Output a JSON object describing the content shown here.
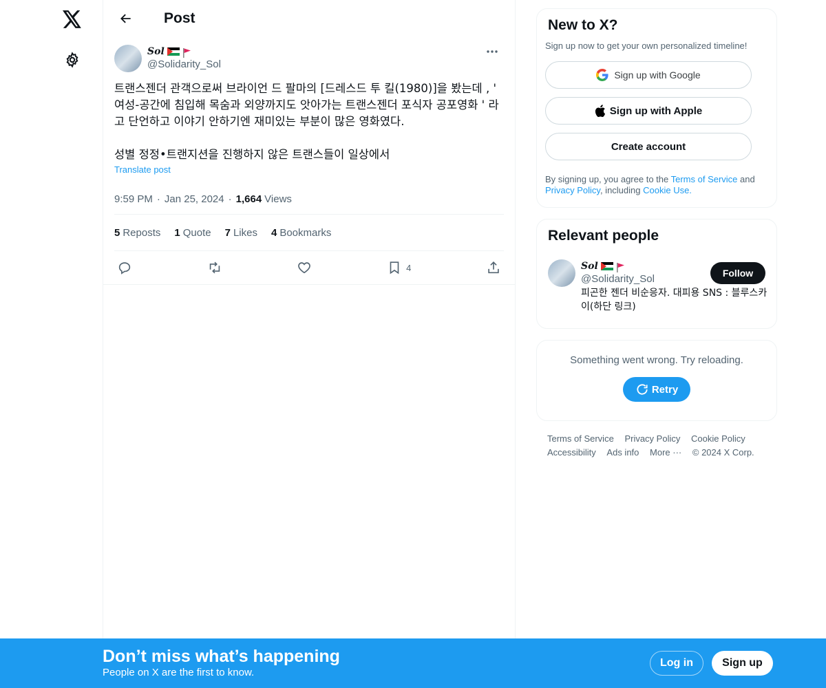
{
  "header": {
    "title": "Post"
  },
  "post": {
    "display_name": "Sol",
    "handle": "@Solidarity_Sol",
    "text_1": "트랜스젠더 관객으로써 브라이언 드 팔마의 [드레스드 투 킬(1980)]을 봤는데 , ' 여성-공간에 침입해 목숨과 외양까지도 앗아가는 트랜스젠더 포식자 공포영화 ' 라고 단언하고 이야기 안하기엔 재미있는 부분이 많은 영화였다.",
    "text_2": "성별 정정•트랜지션을 진행하지 않은 트랜스들이 일상에서",
    "translate": "Translate post",
    "time": "9:59 PM",
    "date": "Jan 25, 2024",
    "views_count": "1,664",
    "views_label": "Views",
    "stats": [
      {
        "count": "5",
        "label": "Reposts"
      },
      {
        "count": "1",
        "label": "Quote"
      },
      {
        "count": "7",
        "label": "Likes"
      },
      {
        "count": "4",
        "label": "Bookmarks"
      }
    ],
    "bookmark_count": "4"
  },
  "signup": {
    "title": "New to X?",
    "subtitle": "Sign up now to get your own personalized timeline!",
    "google": "Sign up with Google",
    "apple": "Sign up with Apple",
    "create": "Create account",
    "terms_1": "By signing up, you agree to the ",
    "terms_tos": "Terms of Service",
    "terms_2": " and ",
    "terms_pp": "Privacy Policy",
    "terms_3": ", including ",
    "terms_cookie": "Cookie Use."
  },
  "people": {
    "title": "Relevant people",
    "display_name": "Sol",
    "handle": "@Solidarity_Sol",
    "follow": "Follow",
    "bio": "피곤한 젠더 비순응자. 대피용 SNS : 블루스카이(하단 링크)"
  },
  "error": {
    "text": "Something went wrong. Try reloading.",
    "retry": "Retry"
  },
  "footer": {
    "links": [
      "Terms of Service",
      "Privacy Policy",
      "Cookie Policy",
      "Accessibility",
      "Ads info",
      "More ···",
      "© 2024 X Corp."
    ]
  },
  "banner": {
    "title": "Don’t miss what’s happening",
    "subtitle": "People on X are the first to know.",
    "login": "Log in",
    "signup": "Sign up"
  },
  "colors": {
    "accent": "#1d9bf0",
    "text": "#0f1419",
    "muted": "#536471"
  }
}
